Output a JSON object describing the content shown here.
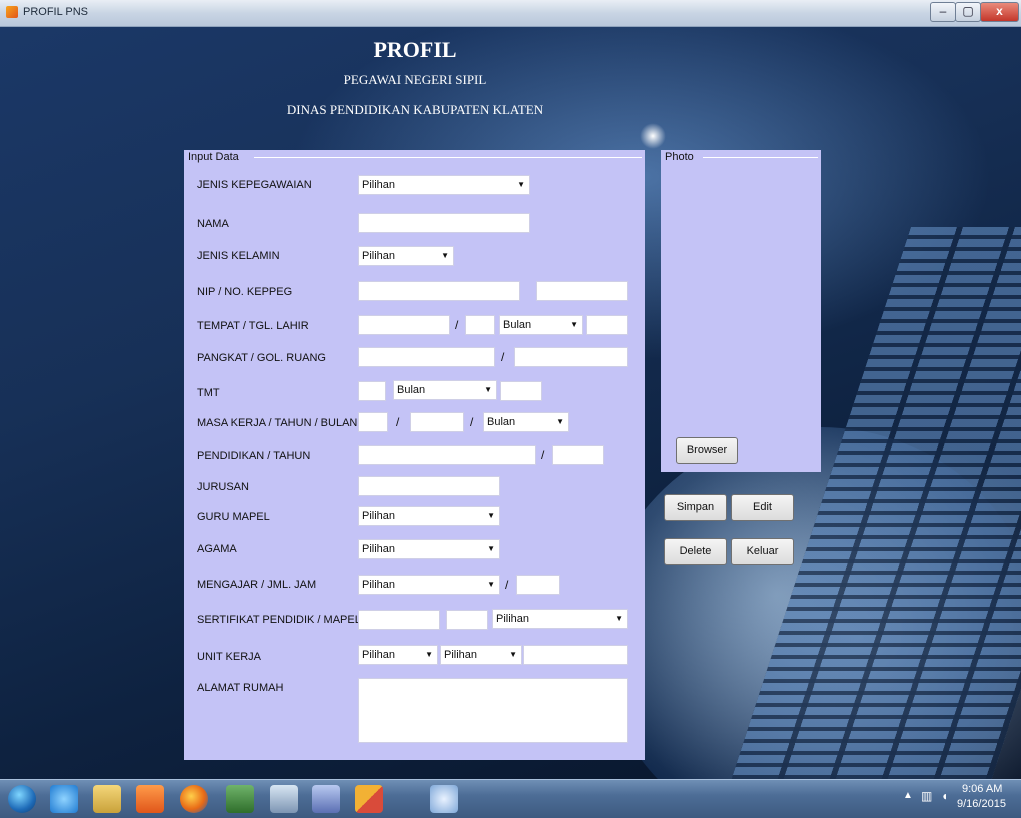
{
  "window": {
    "title": "PROFIL PNS",
    "min": "–",
    "max": "▢",
    "close": "x"
  },
  "header": {
    "title": "PROFIL",
    "subtitle1": "PEGAWAI NEGERI SIPIL",
    "subtitle2": "DINAS PENDIDIKAN KABUPATEN KLATEN"
  },
  "input_group": {
    "legend": "Input Data",
    "labels": {
      "jenis_kepegawaian": "JENIS KEPEGAWAIAN",
      "nama": "NAMA",
      "jenis_kelamin": "JENIS KELAMIN",
      "nip": "NIP / NO. KEPPEG",
      "tempat_tgl_lahir": "TEMPAT / TGL. LAHIR",
      "pangkat": "PANGKAT / GOL. RUANG",
      "tmt": "TMT",
      "masa_kerja": "MASA KERJA / TAHUN / BULAN",
      "pendidikan": "PENDIDIKAN / TAHUN",
      "jurusan": "JURUSAN",
      "guru_mapel": "GURU MAPEL",
      "agama": "AGAMA",
      "mengajar": "MENGAJAR / JML. JAM",
      "sertifikat": "SERTIFIKAT PENDIDIK / MAPEL",
      "unit_kerja": "UNIT KERJA",
      "alamat": "ALAMAT RUMAH"
    },
    "combos": {
      "jenis_kepegawaian": "Pilihan",
      "jenis_kelamin": "Pilihan",
      "lahir_bulan": "Bulan",
      "tmt_bulan": "Bulan",
      "masa_kerja_bulan": "Bulan",
      "guru_mapel": "Pilihan",
      "agama": "Pilihan",
      "mengajar": "Pilihan",
      "sertifikat": "Pilihan",
      "unit_kerja_1": "Pilihan",
      "unit_kerja_2": "Pilihan"
    },
    "separator": "/"
  },
  "photo_group": {
    "legend": "Photo",
    "browse_label": "Browser"
  },
  "actions": {
    "simpan": "Simpan",
    "edit": "Edit",
    "delete": "Delete",
    "keluar": "Keluar"
  },
  "taskbar": {
    "time": "9:06 AM",
    "date": "9/16/2015"
  }
}
